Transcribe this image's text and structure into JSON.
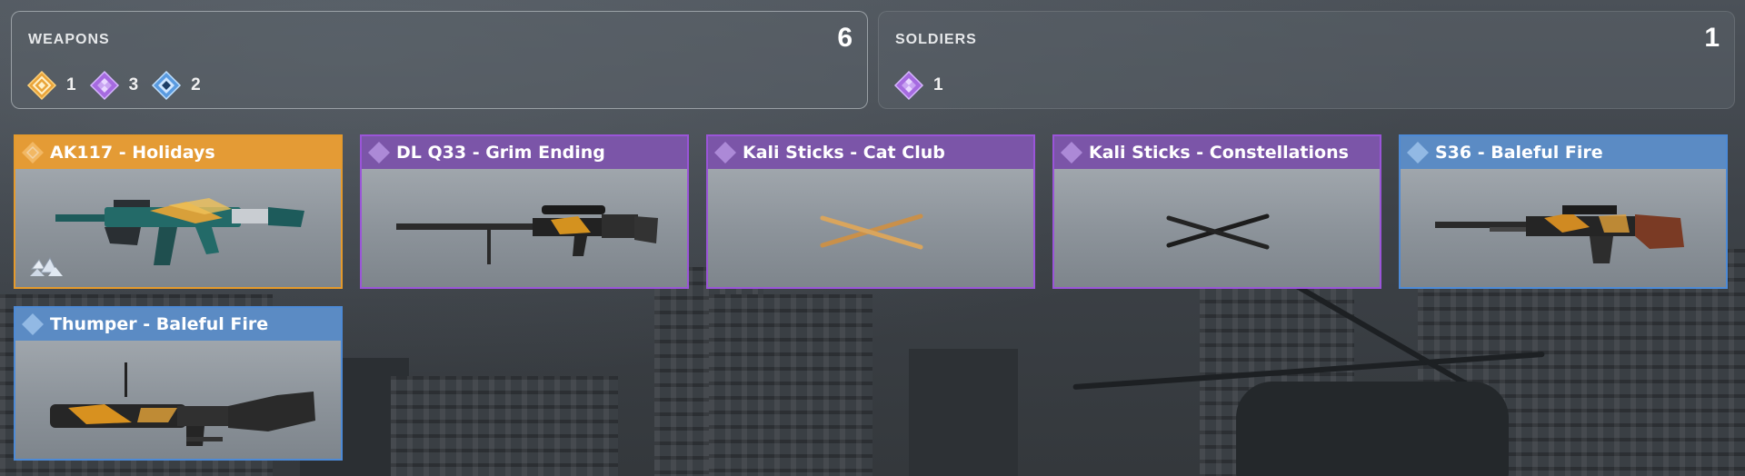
{
  "colors": {
    "legendary": "#e49b35",
    "epic": "#7b55a8",
    "rare": "#5b8bc4"
  },
  "summary": {
    "weapons": {
      "title": "WEAPONS",
      "count": "6",
      "rarities": [
        {
          "tier": "legendary",
          "icon": "legendary-diamond-icon",
          "count": "1"
        },
        {
          "tier": "epic",
          "icon": "epic-diamond-icon",
          "count": "3"
        },
        {
          "tier": "rare",
          "icon": "rare-diamond-icon",
          "count": "2"
        }
      ]
    },
    "soldiers": {
      "title": "SOLDIERS",
      "count": "1",
      "rarities": [
        {
          "tier": "epic",
          "icon": "epic-diamond-icon",
          "count": "1"
        }
      ]
    }
  },
  "items": [
    {
      "name": "AK117 - Holidays",
      "tier": "legendary",
      "art": "assault-rifle"
    },
    {
      "name": "DL Q33 - Grim Ending",
      "tier": "epic",
      "art": "sniper-rifle"
    },
    {
      "name": "Kali Sticks - Cat Club",
      "tier": "epic",
      "art": "kali-sticks-gold"
    },
    {
      "name": "Kali Sticks - Constellations",
      "tier": "epic",
      "art": "kali-sticks-black"
    },
    {
      "name": "S36 - Baleful Fire",
      "tier": "rare",
      "art": "light-machine-gun"
    },
    {
      "name": "Thumper - Baleful Fire",
      "tier": "rare",
      "art": "grenade-launcher"
    }
  ]
}
